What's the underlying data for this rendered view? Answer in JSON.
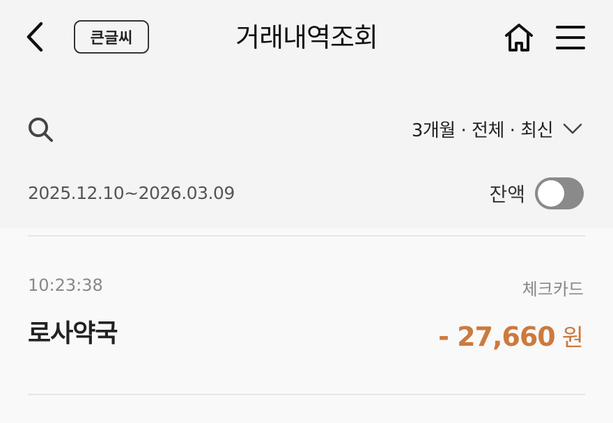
{
  "header": {
    "title": "거래내역조회",
    "big_font_label": "큰글씨",
    "back_icon": "chevron-left-icon",
    "home_icon": "home-icon",
    "menu_icon": "hamburger-menu-icon"
  },
  "filter": {
    "search_icon": "search-icon",
    "label": "3개월 · 전체 · 최신",
    "dropdown_icon": "chevron-down-icon"
  },
  "period": {
    "date_range": "2025.12.10~2026.03.09"
  },
  "balance": {
    "label": "잔액",
    "toggle_on": false
  },
  "transactions": [
    {
      "time": "10:23:38",
      "type": "체크카드",
      "merchant": "로사약국",
      "amount": "- 27,660",
      "unit": "원"
    }
  ],
  "colors": {
    "accent_amount": "#cc7a3e",
    "toggle_off": "#8a8a8a",
    "header_bg": "#f4f4f4",
    "list_bg": "#f9f9f9"
  }
}
